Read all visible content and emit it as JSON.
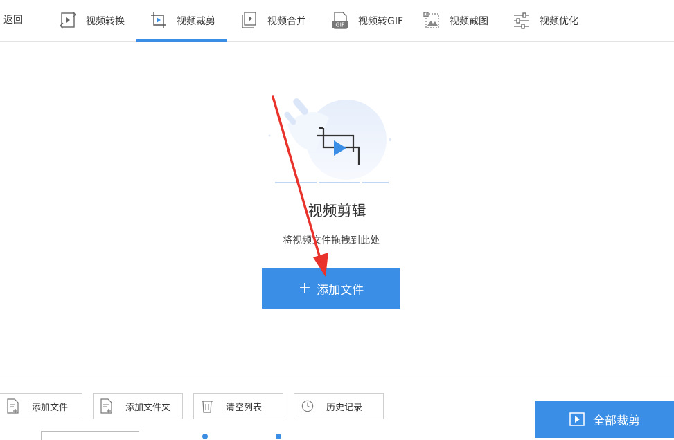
{
  "topbar": {
    "back_label": "返回",
    "tabs": [
      {
        "label": "视频转换",
        "icon": "video-convert-icon",
        "active": false
      },
      {
        "label": "视频裁剪",
        "icon": "video-crop-icon",
        "active": true
      },
      {
        "label": "视频合并",
        "icon": "video-merge-icon",
        "active": false
      },
      {
        "label": "视频转GIF",
        "icon": "gif-icon",
        "active": false
      },
      {
        "label": "视频截图",
        "icon": "screenshot-icon",
        "active": false
      },
      {
        "label": "视频优化",
        "icon": "optimize-icon",
        "active": false
      }
    ],
    "gif_badge": "GIF"
  },
  "dropzone": {
    "title": "视频剪辑",
    "subtitle": "将视频文件拖拽到此处",
    "add_button_label": "添加文件",
    "add_button_icon": "plus-icon"
  },
  "bottombar": {
    "buttons": [
      {
        "label": "添加文件",
        "icon": "add-file-icon"
      },
      {
        "label": "添加文件夹",
        "icon": "add-folder-icon"
      },
      {
        "label": "清空列表",
        "icon": "trash-icon"
      },
      {
        "label": "历史记录",
        "icon": "history-icon"
      }
    ],
    "primary_label": "全部裁剪",
    "primary_icon": "play-icon"
  },
  "colors": {
    "accent": "#3a8ee6",
    "annotation_arrow": "#e8322b",
    "border": "#e3e3e3"
  }
}
